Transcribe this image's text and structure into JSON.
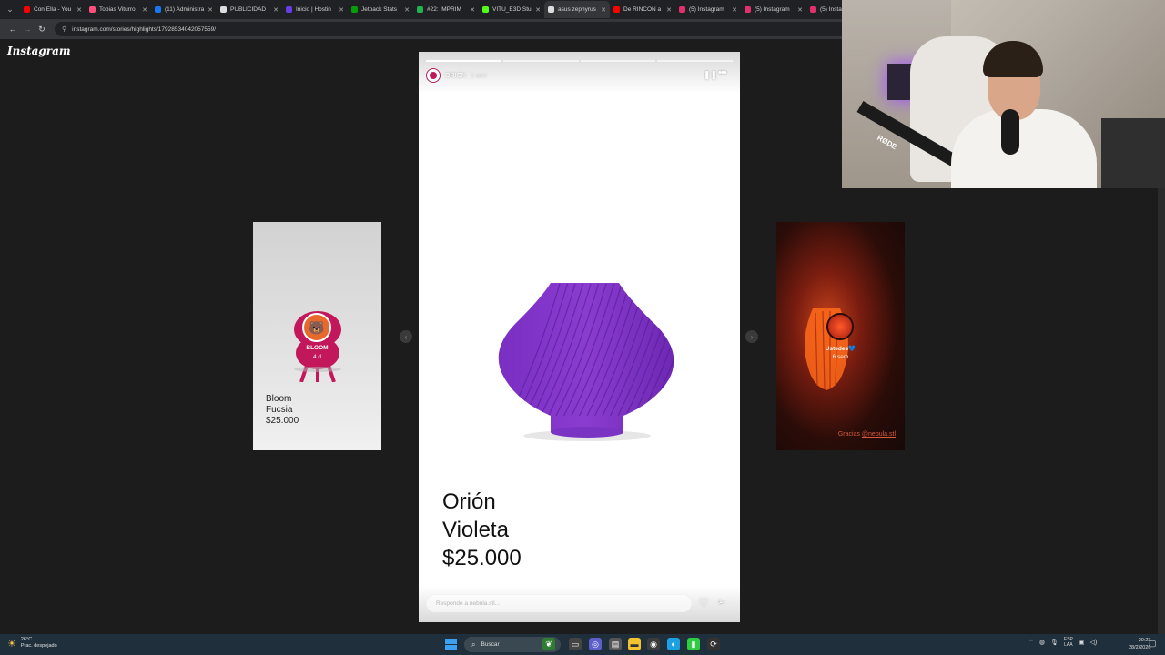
{
  "browser": {
    "tabs": [
      {
        "label": "Con Ella - You",
        "color": "#ff0000"
      },
      {
        "label": "Tobias Viturro",
        "color": "#ff4f7a"
      },
      {
        "label": "(11) Administra",
        "color": "#1877f2"
      },
      {
        "label": "PUBLICIDAD",
        "color": "#dddddd"
      },
      {
        "label": "Inicio | Hostin",
        "color": "#673de6"
      },
      {
        "label": "Jetpack Stats",
        "color": "#069e08"
      },
      {
        "label": "#22: IMPRIM",
        "color": "#21b352"
      },
      {
        "label": "VITU_E3D Stu",
        "color": "#53fc18"
      },
      {
        "label": "asus zephyrus",
        "color": "#dddddd"
      },
      {
        "label": "De RINCÓN a",
        "color": "#ff0000"
      },
      {
        "label": "(5) Instagram",
        "color": "#e1306c"
      },
      {
        "label": "(5) Instagram",
        "color": "#e1306c"
      },
      {
        "label": "(5) Instag",
        "color": "#e1306c"
      }
    ],
    "active_tab_index": 8,
    "url": "instagram.com/stories/highlights/17928534042057559/"
  },
  "instagram": {
    "logo": "Instagram",
    "left_card": {
      "title": "BLOOM",
      "time": "4 d",
      "lines": [
        "Bloom",
        "Fucsia",
        "$25.000"
      ]
    },
    "right_card": {
      "title": "Ustedes💙",
      "time": "6 sem",
      "credit_prefix": "Gracias ",
      "credit_handle": "@nebula.stl"
    },
    "story": {
      "username": "ORIÓN",
      "time": "1 sem",
      "progress_segments": 4,
      "progress_done": 1,
      "text_lines": [
        "Orión",
        "Violeta",
        "$25.000"
      ],
      "reply_placeholder": "Responde a nebula.stl...",
      "vase_color": "#8a3ccf"
    }
  },
  "taskbar": {
    "weather_temp": "26°C",
    "weather_desc": "Prac. despejado",
    "search_label": "Buscar",
    "lang_top": "ESP",
    "lang_bottom": "LAA",
    "time": "20:23",
    "date": "28/2/2026"
  }
}
